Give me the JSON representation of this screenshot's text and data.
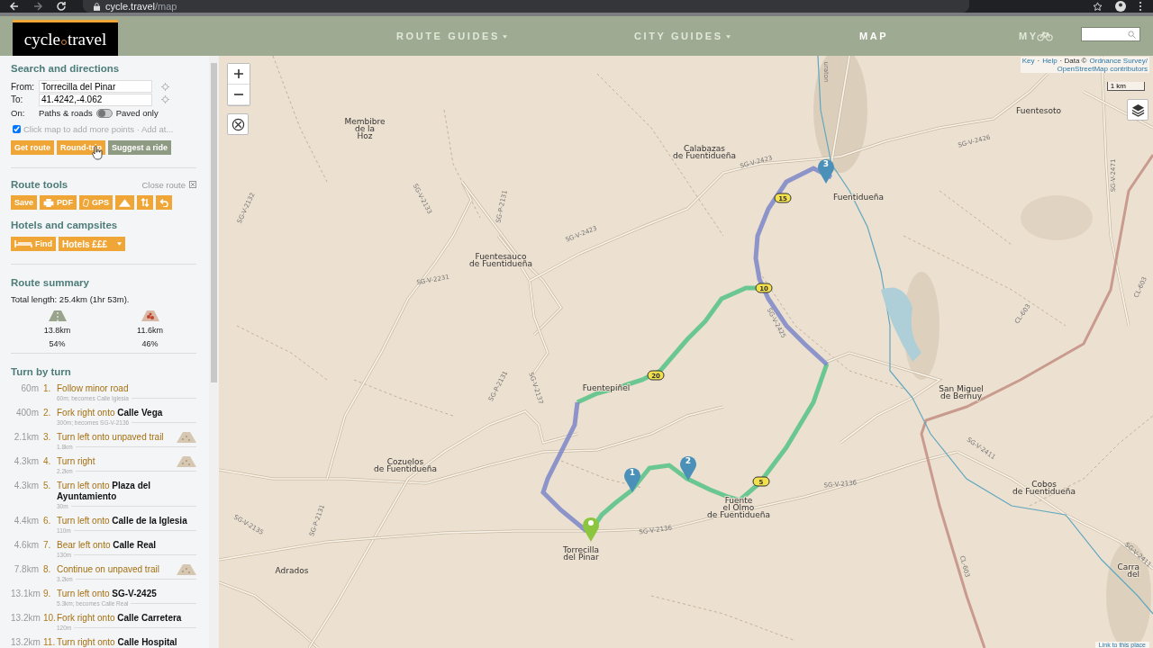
{
  "browser": {
    "url_host": "cycle.travel",
    "url_path": "/map"
  },
  "header": {
    "logo": "cycle",
    "logo_b": "travel",
    "nav": [
      {
        "label": "ROUTE GUIDES",
        "dropdown": true,
        "selected": false
      },
      {
        "label": "CITY GUIDES",
        "dropdown": true,
        "selected": false
      },
      {
        "label": "MAP",
        "dropdown": false,
        "selected": true
      },
      {
        "label": "MY",
        "dropdown": false,
        "selected": false
      }
    ]
  },
  "search": {
    "title": "Search and directions",
    "from_label": "From:",
    "from_value": "Torrecilla del Pinar",
    "to_label": "To:",
    "to_value": "41.4242,-4.062",
    "on_label": "On:",
    "paths_label": "Paths & roads",
    "paved_only": {
      "label": "Paved only",
      "on": false
    },
    "add_points": {
      "label": "Click map to add more points · Add at...",
      "checked": true
    },
    "buttons": [
      {
        "label": "Get route",
        "kind": "primary"
      },
      {
        "label": "Round-trip",
        "kind": "primary"
      },
      {
        "label": "Suggest a ride",
        "kind": "secondary"
      }
    ]
  },
  "route_tools": {
    "title": "Route tools",
    "close": "Close route",
    "buttons": [
      {
        "kind": "save",
        "label": "Save"
      },
      {
        "kind": "pdf",
        "label": "PDF"
      },
      {
        "kind": "gps",
        "label": "GPS"
      },
      {
        "kind": "elevation"
      },
      {
        "kind": "reverse"
      },
      {
        "kind": "undo"
      }
    ]
  },
  "hotels": {
    "title": "Hotels and campsites",
    "find": "Find",
    "select": "Hotels £££"
  },
  "summary": {
    "title": "Route summary",
    "total": "Total length: 25.4km (1hr 53m).",
    "parts": [
      {
        "kind": "paved",
        "distance": "13.8km",
        "percent": "54%"
      },
      {
        "kind": "unpaved",
        "distance": "11.6km",
        "percent": "46%"
      }
    ]
  },
  "turns": {
    "title": "Turn by turn",
    "rows": [
      {
        "at": "60m",
        "num": "1.",
        "text": "Follow minor road",
        "note": "60m; becomes Calle Iglesia",
        "unpaved": false
      },
      {
        "at": "400m",
        "num": "2.",
        "text": "Fork right onto **Calle Vega**",
        "note": "300m; becomes SG-V-2136",
        "unpaved": false
      },
      {
        "at": "2.1km",
        "num": "3.",
        "text": "Turn left onto unpaved trail",
        "note": "1.8km",
        "unpaved": true
      },
      {
        "at": "4.3km",
        "num": "4.",
        "text": "Turn right",
        "note": "2.2km",
        "unpaved": true
      },
      {
        "at": "4.3km",
        "num": "5.",
        "text": "Turn left onto **Plaza del Ayuntamiento**",
        "note": "30m",
        "unpaved": false
      },
      {
        "at": "4.4km",
        "num": "6.",
        "text": "Turn left onto **Calle de la Iglesia**",
        "note": "110m",
        "unpaved": false
      },
      {
        "at": "4.6km",
        "num": "7.",
        "text": "Bear left onto **Calle Real**",
        "note": "130m",
        "unpaved": false
      },
      {
        "at": "7.8km",
        "num": "8.",
        "text": "Continue on unpaved trail",
        "note": "3.2km",
        "unpaved": true
      },
      {
        "at": "13.1km",
        "num": "9.",
        "text": "Turn left onto **SG-V-2425**",
        "note": "5.3km; becomes Calle Real",
        "unpaved": false
      },
      {
        "at": "13.2km",
        "num": "10.",
        "text": "Fork right onto **Calle Carretera**",
        "note": "120m",
        "unpaved": false
      },
      {
        "at": "13.2km",
        "num": "11.",
        "text": "Turn right onto **Calle Hospital**",
        "unpaved": false
      }
    ]
  },
  "map": {
    "attribution": [
      {
        "kind": "link",
        "text": "Key"
      },
      {
        "kind": "sep",
        "text": "·"
      },
      {
        "kind": "link",
        "text": "Help"
      },
      {
        "kind": "sep",
        "text": "· Data ©"
      },
      {
        "kind": "link",
        "text": "Ordnance Survey/"
      },
      {
        "kind": "link",
        "text": "OpenStreetMap contributors"
      }
    ],
    "scale": "1 km",
    "link": "Link to this place",
    "places": [
      [
        "Membibre",
        "de la",
        "Hoz"
      ],
      [
        "Calabazas",
        "de Fuentidueña"
      ],
      [
        "Fuentesoto"
      ],
      [
        "Fuentidueña"
      ],
      [
        "Fuentesauco",
        "de Fuentidueña"
      ],
      [
        "Fuentepiñel"
      ],
      [
        "San Miguel",
        "de Bernuy"
      ],
      [
        "Cozuelos",
        "de Fuentidueña"
      ],
      [
        "Fuente",
        "el Olmo",
        "de Fuentidueña"
      ],
      [
        "Torrecilla",
        "del Pinar"
      ],
      [
        "Cobos",
        "de Fuentidueña"
      ],
      [
        "Adrados"
      ],
      [
        "Carra",
        "del"
      ]
    ],
    "roads": [
      "SG-V-2132",
      "SG-V-2133",
      "SG-P-2131",
      "SG-V-2423",
      "SG-V-2423",
      "SG-V-2231",
      "SG-P-2131",
      "SG-V-2137",
      "SG-P-2131",
      "SG-V-2135",
      "SG-V-2136",
      "SG-V-2136",
      "SG-V-2425",
      "SG-V-2426",
      "SG-V-2471",
      "CL-603",
      "CL-603",
      "CL-603",
      "SG-V-2411",
      "SG-V-2411",
      "uraton"
    ],
    "km_markers": [
      "5",
      "10",
      "15",
      "20"
    ],
    "waypoints": [
      "1",
      "2",
      "3"
    ]
  }
}
